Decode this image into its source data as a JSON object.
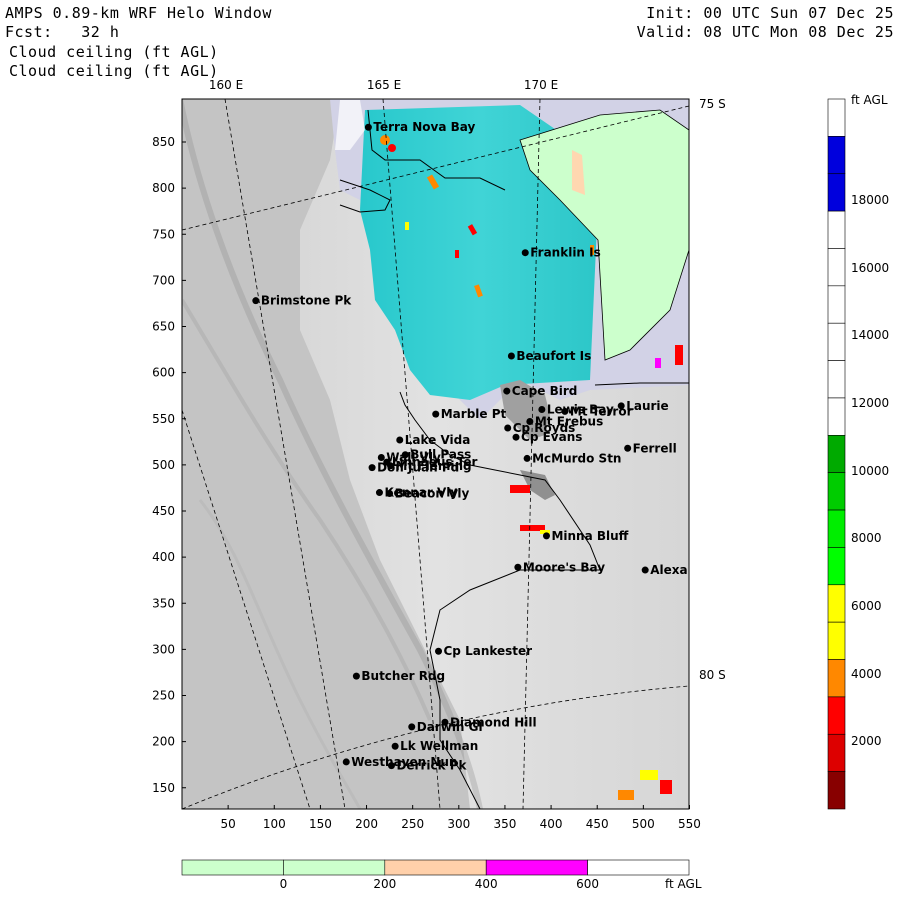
{
  "header": {
    "title": "AMPS 0.89-km WRF Helo Window",
    "fcst": "Fcst:   32 h",
    "field1": "Cloud ceiling (ft AGL)",
    "field2": "Cloud ceiling (ft AGL)",
    "init": "Init: 00 UTC Sun 07 Dec 25",
    "valid": "Valid: 08 UTC Mon 08 Dec 25"
  },
  "map": {
    "lon_labels": [
      "160 E",
      "165 E",
      "170 E"
    ],
    "lat_labels": [
      "75 S",
      "80 S"
    ],
    "x_ticks": [
      "50",
      "100",
      "150",
      "200",
      "250",
      "300",
      "350",
      "400",
      "450",
      "500",
      "550"
    ],
    "y_ticks": [
      "850",
      "800",
      "750",
      "700",
      "650",
      "600",
      "550",
      "500",
      "450",
      "400",
      "350",
      "300",
      "250",
      "200",
      "150"
    ],
    "places": [
      {
        "name": "Terra Nova Bay",
        "x": 202,
        "y": 866
      },
      {
        "name": "Franklin Is",
        "x": 372,
        "y": 730
      },
      {
        "name": "Brimstone Pk",
        "x": 80,
        "y": 678
      },
      {
        "name": "Beaufort Is",
        "x": 357,
        "y": 618
      },
      {
        "name": "Cape Bird",
        "x": 352,
        "y": 580
      },
      {
        "name": "Lewis Bay",
        "x": 390,
        "y": 560
      },
      {
        "name": "Laurie",
        "x": 476,
        "y": 564
      },
      {
        "name": "Mt Terror",
        "x": 415,
        "y": 558
      },
      {
        "name": "Marble Pt",
        "x": 275,
        "y": 555
      },
      {
        "name": "Mt Erebus",
        "x": 377,
        "y": 547
      },
      {
        "name": "Cp Royds",
        "x": 353,
        "y": 540
      },
      {
        "name": "Lake Vida",
        "x": 236,
        "y": 527
      },
      {
        "name": "Cp Evans",
        "x": 362,
        "y": 530
      },
      {
        "name": "Ferrell",
        "x": 483,
        "y": 518
      },
      {
        "name": "Wall Vly",
        "x": 216,
        "y": 508
      },
      {
        "name": "Bull Pass",
        "x": 242,
        "y": 511
      },
      {
        "name": "McMurdo Stn",
        "x": 374,
        "y": 507
      },
      {
        "name": "Don Juan Pd",
        "x": 206,
        "y": 497
      },
      {
        "name": "Mt Fleming",
        "x": 226,
        "y": 499
      },
      {
        "name": "Linnaeus Ter",
        "x": 222,
        "y": 503
      },
      {
        "name": "Kennar Vly",
        "x": 214,
        "y": 470
      },
      {
        "name": "Beacon Vly",
        "x": 225,
        "y": 469
      },
      {
        "name": "Minna Bluff",
        "x": 395,
        "y": 423
      },
      {
        "name": "Moore's Bay",
        "x": 364,
        "y": 389
      },
      {
        "name": "Alexander",
        "x": 502,
        "y": 386
      },
      {
        "name": "Cp Lankester",
        "x": 278,
        "y": 298
      },
      {
        "name": "Butcher Rdg",
        "x": 189,
        "y": 271
      },
      {
        "name": "Diamond Hill",
        "x": 285,
        "y": 221
      },
      {
        "name": "Darwin Gl",
        "x": 249,
        "y": 216
      },
      {
        "name": "Lk Wellman",
        "x": 231,
        "y": 195
      },
      {
        "name": "Westhaven Nun",
        "x": 178,
        "y": 178
      },
      {
        "name": "Derrick Pk",
        "x": 227,
        "y": 174
      }
    ]
  },
  "colorbar_right": {
    "unit": "ft AGL",
    "labels": [
      "18000",
      "16000",
      "14000",
      "12000",
      "10000",
      "8000",
      "6000",
      "4000",
      "2000"
    ],
    "colors": [
      "#ffffff",
      "#0000dd",
      "#0000dd",
      "#ffffff",
      "#ffffff",
      "#ffffff",
      "#ffffff",
      "#ffffff",
      "#ffffff",
      "#00aa00",
      "#00cc00",
      "#00ee00",
      "#00ff00",
      "#ffff00",
      "#ffff00",
      "#ff8800",
      "#ff0000",
      "#dd0000",
      "#880000"
    ]
  },
  "colorbar_bottom": {
    "unit": "ft AGL",
    "labels": [
      "0",
      "200",
      "400",
      "600"
    ],
    "colors": [
      "#ccffcc",
      "#ccffcc",
      "#ffd0aa",
      "#ff00ff",
      "#ffffff"
    ]
  }
}
